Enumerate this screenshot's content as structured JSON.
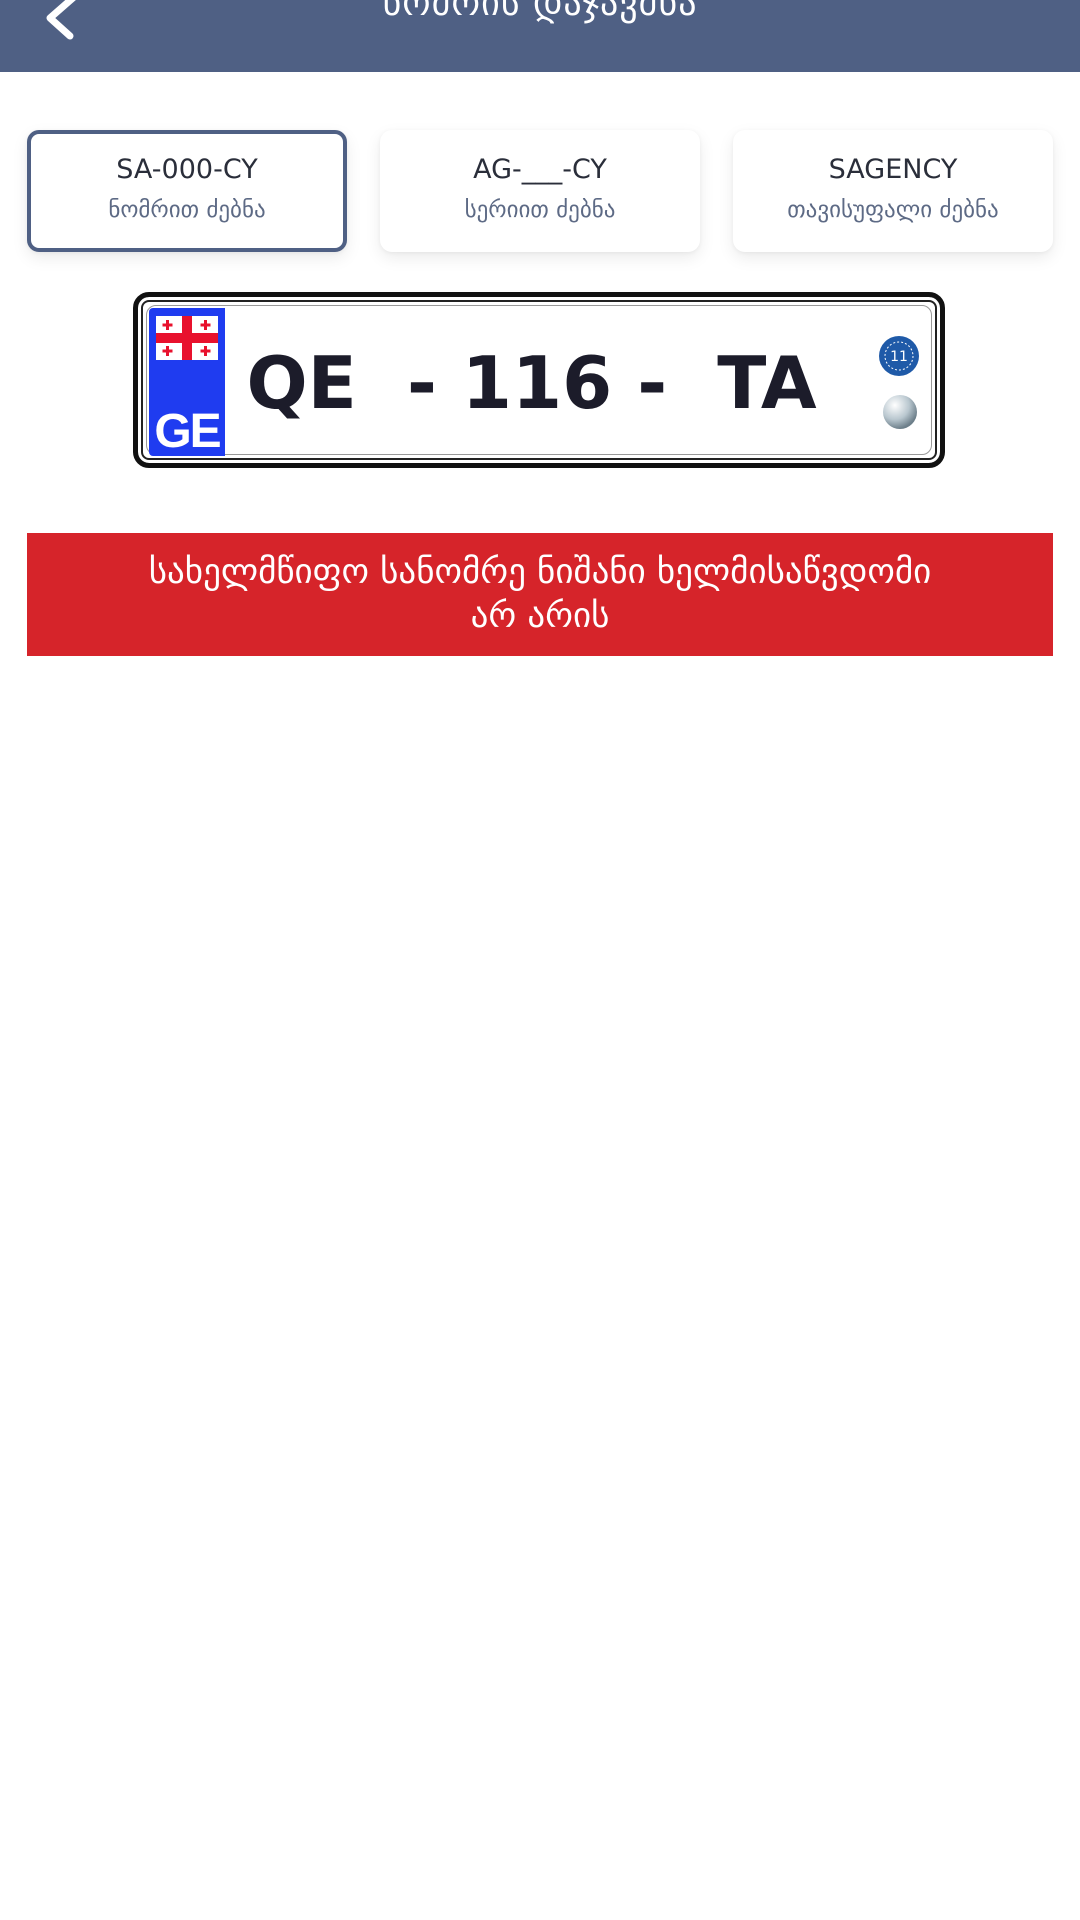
{
  "header": {
    "title": "ნომრის დაჯავშნა"
  },
  "tabs": [
    {
      "title": "SA-000-CY",
      "subtitle": "ნომრით ძებნა",
      "active": true
    },
    {
      "title": "AG-___-CY",
      "subtitle": "სერიით ძებნა",
      "active": false
    },
    {
      "title": "SAGENCY",
      "subtitle": "თავისუფალი ძებნა",
      "active": false
    }
  ],
  "plate": {
    "country_code": "GE",
    "number": "QE  - 116 -  TA",
    "sticker_number": "11",
    "band_color": "#1f3cf0"
  },
  "alert": {
    "line1": "სახელმწიფო სანომრე ნიშანი ხელმისაწვდომი",
    "line2": "არ არის",
    "color": "#d6242a"
  },
  "colors": {
    "header": "#4f6084",
    "active_border": "#4f6084"
  }
}
